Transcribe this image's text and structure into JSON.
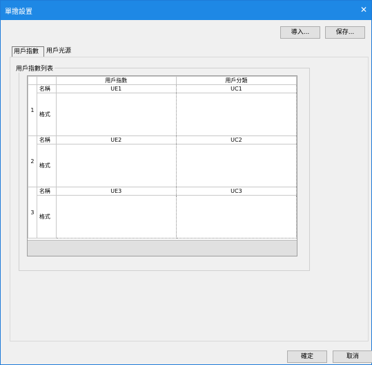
{
  "window": {
    "title": "單擔設置",
    "close_icon": "close-icon"
  },
  "toolbar": {
    "import_label": "導入...",
    "save_label": "保存..."
  },
  "tabs": [
    {
      "label": "用戶指數",
      "active": true
    },
    {
      "label": "用戶光源",
      "active": false
    }
  ],
  "group": {
    "title": "用戶指數列表"
  },
  "table": {
    "columns": [
      "用戶指數",
      "用戶分類"
    ],
    "field_name": "名稱",
    "field_format": "格式",
    "rows": [
      {
        "index": "1",
        "ue": "UE1",
        "uc": "UC1"
      },
      {
        "index": "2",
        "ue": "UE2",
        "uc": "UC2"
      },
      {
        "index": "3",
        "ue": "UE3",
        "uc": "UC3"
      }
    ]
  },
  "footer": {
    "ok_label": "確定",
    "cancel_label": "取消"
  }
}
